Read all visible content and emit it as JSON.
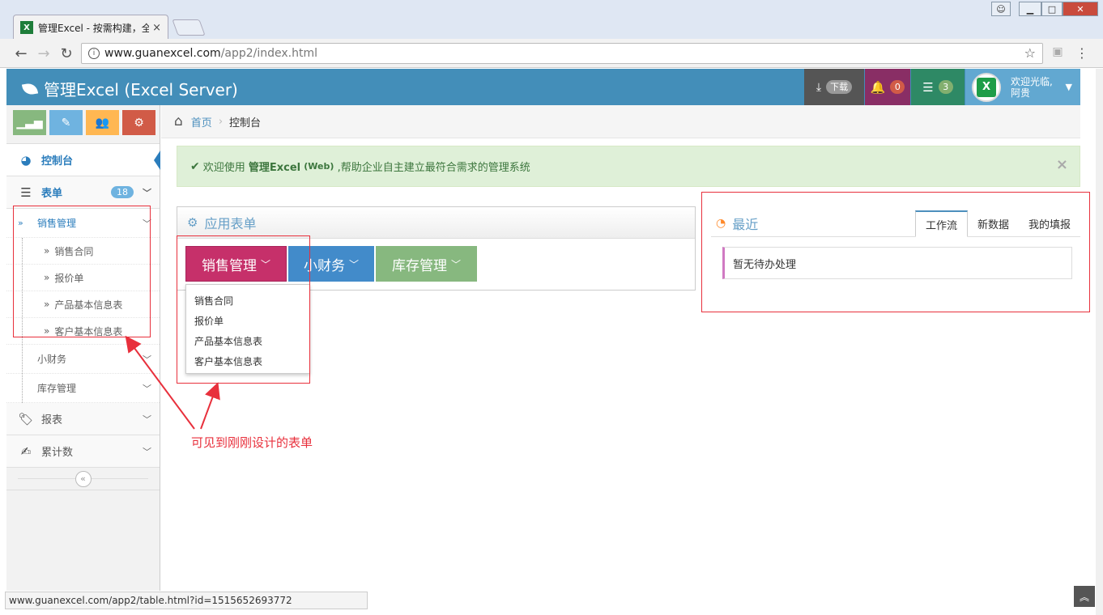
{
  "browser": {
    "tab_title": "管理Excel - 按需构建，全",
    "tab_close": "×",
    "url_domain": "www.guanexcel.com",
    "url_path": "/app2/index.html",
    "status_url": "www.guanexcel.com/app2/table.html?id=1515652693772"
  },
  "header": {
    "brand": "管理Excel (Excel Server)",
    "download_label": "下载",
    "notify_count": "0",
    "task_count": "3",
    "welcome": "欢迎光临,",
    "username": "阿贵",
    "avatar_letter": "X"
  },
  "sidebar": {
    "items": [
      {
        "label": "控制台"
      },
      {
        "label": "表单",
        "count": "18"
      },
      {
        "label": "报表"
      },
      {
        "label": "累计数"
      }
    ],
    "groups": [
      {
        "label": "销售管理"
      },
      {
        "label": "小财务"
      },
      {
        "label": "库存管理"
      }
    ],
    "sales_children": [
      "销售合同",
      "报价单",
      "产品基本信息表",
      "客户基本信息表"
    ]
  },
  "breadcrumb": {
    "home": "首页",
    "current": "控制台"
  },
  "alert": {
    "prefix": "欢迎使用",
    "product": "管理Excel",
    "edition": "(Web)",
    "suffix": ",帮助企业自主建立最符合需求的管理系统",
    "close": "×"
  },
  "app_widget": {
    "title": "应用表单",
    "buttons": [
      "销售管理",
      "小财务",
      "库存管理"
    ],
    "dropdown": [
      "销售合同",
      "报价单",
      "产品基本信息表",
      "客户基本信息表"
    ]
  },
  "recent": {
    "title": "最近",
    "tabs": [
      "工作流",
      "新数据",
      "我的填报"
    ],
    "empty_text": "暂无待办处理"
  },
  "annotation": {
    "text": "可见到刚刚设计的表单"
  },
  "colors": {
    "header_bg": "#438eb9",
    "sales_btn": "#c6306a",
    "finance_btn": "#428bca",
    "inventory_btn": "#87b87f",
    "annotation_red": "#e8303c"
  }
}
